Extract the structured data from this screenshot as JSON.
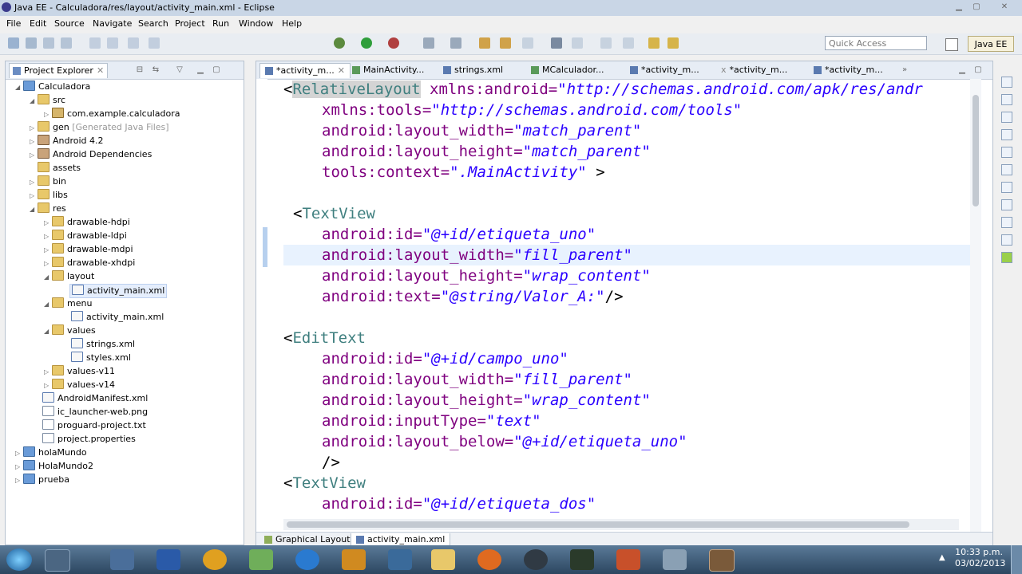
{
  "window": {
    "title": "Java EE - Calculadora/res/layout/activity_main.xml - Eclipse"
  },
  "menu": [
    "File",
    "Edit",
    "Source",
    "Navigate",
    "Search",
    "Project",
    "Run",
    "Window",
    "Help"
  ],
  "toolbar": {
    "quick_access_placeholder": "Quick Access",
    "perspective": "Java EE"
  },
  "project_explorer": {
    "tab_label": "Project Explorer",
    "tree": [
      {
        "label": "Calculadora",
        "icon": "project-icon",
        "expanded": true
      },
      {
        "label": "src",
        "icon": "folder-icon",
        "expanded": true
      },
      {
        "label": "com.example.calculadora",
        "icon": "package-icon"
      },
      {
        "label": "gen",
        "suffix": "[Generated Java Files]",
        "icon": "folder-icon"
      },
      {
        "label": "Android 4.2",
        "icon": "library-icon"
      },
      {
        "label": "Android Dependencies",
        "icon": "library-icon"
      },
      {
        "label": "assets",
        "icon": "folder-icon"
      },
      {
        "label": "bin",
        "icon": "folder-icon"
      },
      {
        "label": "libs",
        "icon": "folder-icon"
      },
      {
        "label": "res",
        "icon": "folder-icon",
        "expanded": true
      },
      {
        "label": "drawable-hdpi",
        "icon": "folder-icon"
      },
      {
        "label": "drawable-ldpi",
        "icon": "folder-icon"
      },
      {
        "label": "drawable-mdpi",
        "icon": "folder-icon"
      },
      {
        "label": "drawable-xhdpi",
        "icon": "folder-icon"
      },
      {
        "label": "layout",
        "icon": "folder-icon",
        "expanded": true
      },
      {
        "label": "activity_main.xml",
        "icon": "xml-file-icon",
        "selected": true
      },
      {
        "label": "menu",
        "icon": "folder-icon",
        "expanded": true
      },
      {
        "label": "activity_main.xml",
        "icon": "xml-file-icon"
      },
      {
        "label": "values",
        "icon": "folder-icon",
        "expanded": true
      },
      {
        "label": "strings.xml",
        "icon": "xml-file-icon"
      },
      {
        "label": "styles.xml",
        "icon": "xml-file-icon"
      },
      {
        "label": "values-v11",
        "icon": "folder-icon"
      },
      {
        "label": "values-v14",
        "icon": "folder-icon"
      },
      {
        "label": "AndroidManifest.xml",
        "icon": "xml-file-icon"
      },
      {
        "label": "ic_launcher-web.png",
        "icon": "image-file-icon"
      },
      {
        "label": "proguard-project.txt",
        "icon": "text-file-icon"
      },
      {
        "label": "project.properties",
        "icon": "text-file-icon"
      },
      {
        "label": "holaMundo",
        "icon": "project-icon"
      },
      {
        "label": "HolaMundo2",
        "icon": "project-icon"
      },
      {
        "label": "prueba",
        "icon": "project-icon"
      }
    ]
  },
  "editor": {
    "tabs": [
      "*activity_m...",
      "MainActivity...",
      "strings.xml",
      "MCalculador...",
      "*activity_m...",
      "*activity_m...",
      "*activity_m..."
    ],
    "bottom_tabs": [
      "Graphical Layout",
      "activity_main.xml"
    ],
    "code": {
      "l1": {
        "open": "<",
        "tag": "RelativeLayout",
        "attr": " xmlns:android=",
        "val": "\"http://schemas.android.com/apk/res/andr"
      },
      "l2": {
        "attr": "xmlns:tools=",
        "val": "\"http://schemas.android.com/tools\""
      },
      "l3": {
        "attr": "android:layout_width=",
        "val": "\"match_parent\""
      },
      "l4": {
        "attr": "android:layout_height=",
        "val": "\"match_parent\""
      },
      "l5": {
        "attr": "tools:context=",
        "val": "\".MainActivity\"",
        "close": " >"
      },
      "l7": {
        "open": "<",
        "tag": "TextView"
      },
      "l8": {
        "attr": "android:id=",
        "val": "\"@+id/etiqueta_uno\""
      },
      "l9": {
        "attr": "android:layout_width=",
        "val": "\"fill_parent\""
      },
      "l10": {
        "attr": "android:layout_height=",
        "val": "\"wrap_content\""
      },
      "l11": {
        "attr": "android:text=",
        "val": "\"@string/Valor_A:\"",
        "close": "/>"
      },
      "l13": {
        "open": "<",
        "tag": "EditText"
      },
      "l14": {
        "attr": "android:id=",
        "val": "\"@+id/campo_uno\""
      },
      "l15": {
        "attr": "android:layout_width=",
        "val": "\"fill_parent\""
      },
      "l16": {
        "attr": "android:layout_height=",
        "val": "\"wrap_content\""
      },
      "l17": {
        "attr": "android:inputType=",
        "val": "\"text\""
      },
      "l18": {
        "attr": "android:layout_below=",
        "val": "\"@+id/etiqueta_uno\""
      },
      "l19": {
        "close": "/>"
      },
      "l20": {
        "open": "<",
        "tag": "TextView"
      },
      "l21": {
        "attr": "android:id=",
        "val": "\"@+id/etiqueta_dos\""
      }
    }
  },
  "taskbar": {
    "time": "10:33 p.m.",
    "date": "03/02/2013"
  }
}
